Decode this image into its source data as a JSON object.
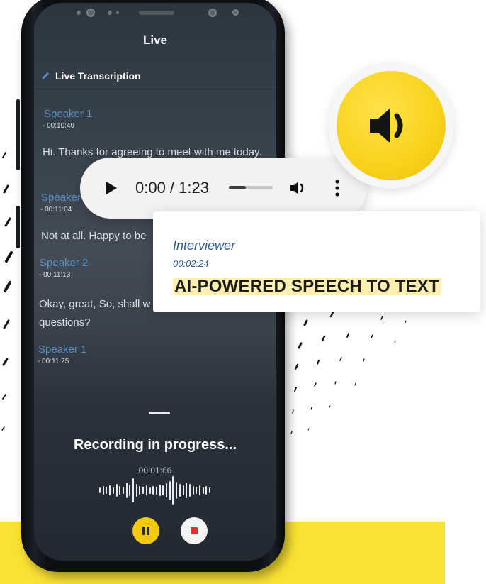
{
  "app": {
    "title": "Live",
    "subtitle": "Live Transcription"
  },
  "transcript": [
    {
      "speaker": "Speaker 1",
      "time": "- 00:10:49",
      "text": "Hi. Thanks for agreeing to meet with me today."
    },
    {
      "speaker": "Speaker 2",
      "time": "- 00:11:04",
      "text": "Not at all. Happy to be"
    },
    {
      "speaker": "Speaker 2",
      "time": "- 00:11:13",
      "text": "Okay, great, So, shall w questions?"
    },
    {
      "speaker": "Speaker 1",
      "time": "- 00:11:25",
      "text": ""
    }
  ],
  "recording": {
    "status": "Recording in progress...",
    "elapsed": "00:01:66"
  },
  "player": {
    "time": "0:00 / 1:23",
    "progress_fraction": 0.38
  },
  "card": {
    "speaker": "Interviewer",
    "time": "00:02:24",
    "headline": "AI-POWERED SPEECH TO TEXT"
  },
  "colors": {
    "accent_yellow": "#f8d21b",
    "band_yellow": "#fae233",
    "speaker_blue": "#5b8fc7",
    "card_blue": "#2f5b8f",
    "highlight": "#fdefb2"
  },
  "icons": [
    "edit-icon",
    "play-icon",
    "volume-icon",
    "more-vert-icon",
    "speaker-volume-icon",
    "pause-icon",
    "stop-icon"
  ]
}
